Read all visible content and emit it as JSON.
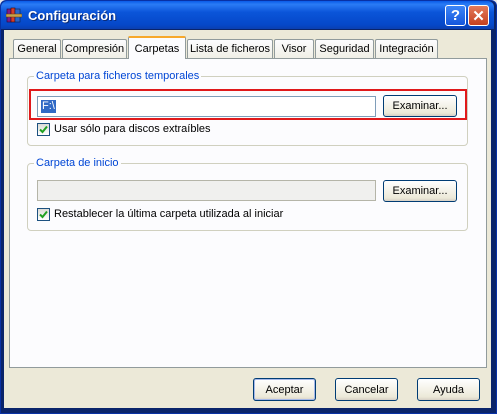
{
  "window": {
    "title": "Configuración",
    "help_glyph": "?",
    "close_glyph": "✕",
    "icon": "winrar-books-icon"
  },
  "tabs": [
    {
      "label": "General",
      "active": false
    },
    {
      "label": "Compresión",
      "active": false
    },
    {
      "label": "Carpetas",
      "active": true
    },
    {
      "label": "Lista de ficheros",
      "active": false
    },
    {
      "label": "Visor",
      "active": false
    },
    {
      "label": "Seguridad",
      "active": false
    },
    {
      "label": "Integración",
      "active": false
    }
  ],
  "temp_folder": {
    "legend": "Carpeta para ficheros temporales",
    "path_value": "F:\\",
    "browse_label": "Examinar...",
    "checkbox_label": "Usar sólo para discos extraíbles",
    "checked": true
  },
  "start_folder": {
    "legend": "Carpeta de inicio",
    "path_value": "",
    "browse_label": "Examinar...",
    "checkbox_label": "Restablecer la última carpeta utilizada al iniciar",
    "checked": true
  },
  "footer": {
    "accept_label": "Aceptar",
    "cancel_label": "Cancelar",
    "help_label": "Ayuda"
  },
  "colors": {
    "titlebar": "#0a55d9",
    "group_label": "#0046d5",
    "active_tab_accent": "#f7a82b",
    "highlight": "#e0191b",
    "selection": "#316ac5"
  }
}
